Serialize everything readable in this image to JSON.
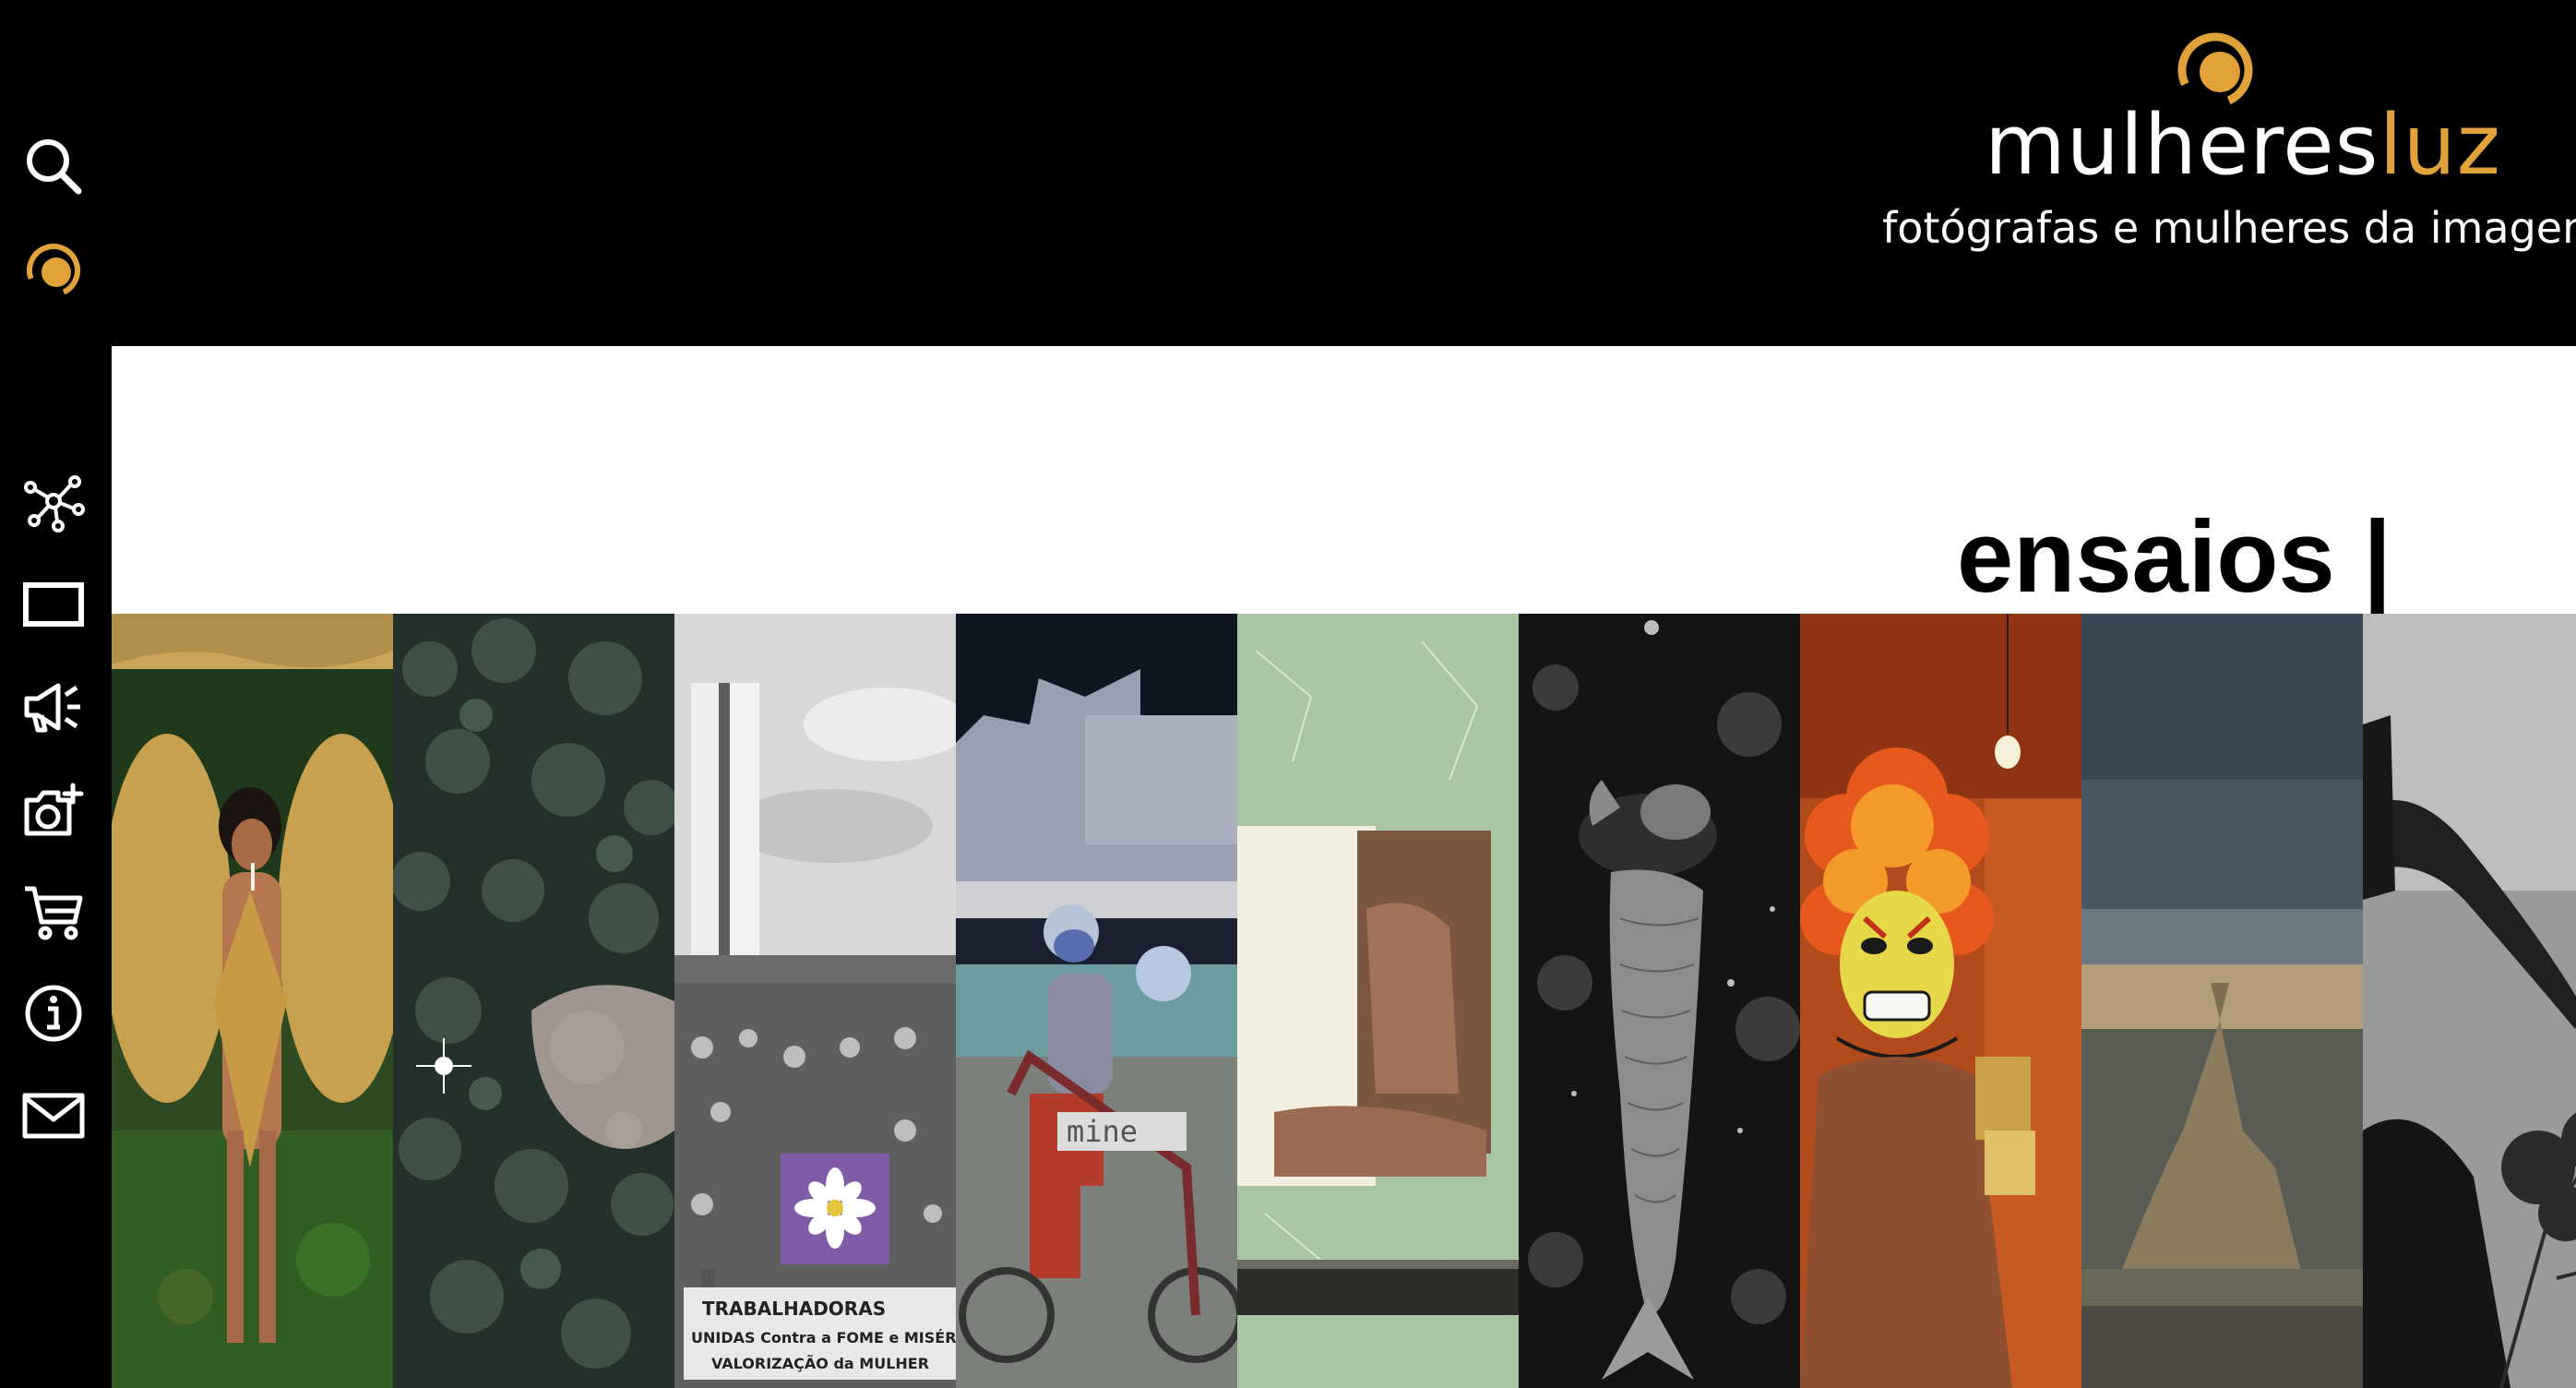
{
  "sidebar": {
    "items": [
      {
        "name": "search-icon"
      },
      {
        "name": "logo-mark-icon"
      },
      {
        "name": "network-icon"
      },
      {
        "name": "screen-icon"
      },
      {
        "name": "megaphone-icon"
      },
      {
        "name": "camera-plus-icon"
      },
      {
        "name": "cart-icon"
      },
      {
        "name": "info-icon"
      },
      {
        "name": "mail-icon"
      }
    ]
  },
  "header": {
    "logo_word_main": "mulheres",
    "logo_word_accent": "luz",
    "tagline": "fotógrafas e mulheres da imagem",
    "accent_color": "#e1a23a"
  },
  "section": {
    "title": "ensaios |"
  },
  "gallery": {
    "tiles": [
      {
        "name": "essay-tile-1"
      },
      {
        "name": "essay-tile-2"
      },
      {
        "name": "essay-tile-3"
      },
      {
        "name": "essay-tile-4"
      },
      {
        "name": "essay-tile-5"
      },
      {
        "name": "essay-tile-6"
      },
      {
        "name": "essay-tile-7"
      },
      {
        "name": "essay-tile-8"
      },
      {
        "name": "essay-tile-9"
      }
    ],
    "tile3_banner_line1": "TRABALHADORAS",
    "tile3_banner_line2": "UNIDAS Contra a FOME e MISÉRIA",
    "tile3_banner_line3": "VALORIZAÇÃO da MULHER",
    "tile4_label": "mine"
  }
}
